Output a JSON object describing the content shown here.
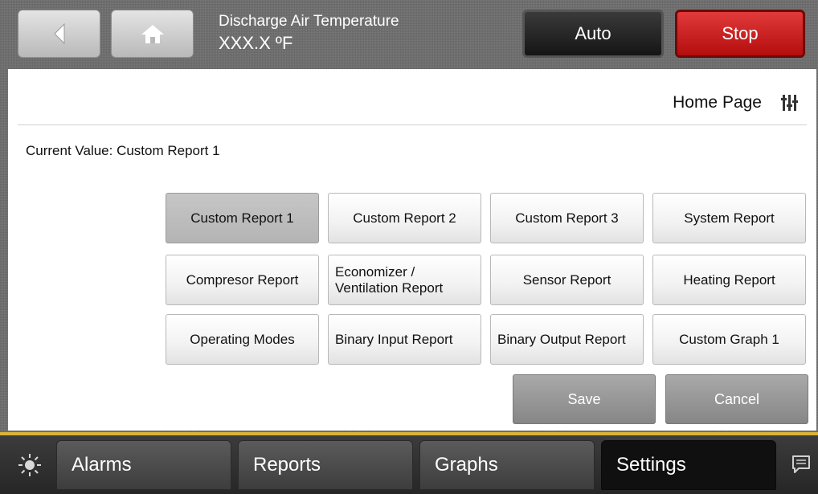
{
  "header": {
    "title": "Discharge Air Temperature",
    "value": "XXX.X ºF",
    "auto_label": "Auto",
    "stop_label": "Stop",
    "stop_color": "#c81818"
  },
  "panel": {
    "page_title": "Home Page",
    "current_value": "Current Value: Custom Report 1",
    "options": [
      {
        "label": "Custom Report 1",
        "selected": true
      },
      {
        "label": "Custom Report 2",
        "selected": false
      },
      {
        "label": "Custom Report 3",
        "selected": false
      },
      {
        "label": "System Report",
        "selected": false
      },
      {
        "label": "Compresor Report",
        "selected": false
      },
      {
        "label": "Economizer / Ventilation Report",
        "selected": false
      },
      {
        "label": "Sensor Report",
        "selected": false
      },
      {
        "label": "Heating Report",
        "selected": false
      },
      {
        "label": "Operating Modes",
        "selected": false
      },
      {
        "label": "Binary Input Report",
        "selected": false
      },
      {
        "label": "Binary Output Report",
        "selected": false
      },
      {
        "label": "Custom Graph 1",
        "selected": false
      }
    ],
    "save_label": "Save",
    "cancel_label": "Cancel"
  },
  "nav": {
    "tabs": [
      {
        "label": "Alarms",
        "active": false
      },
      {
        "label": "Reports",
        "active": false
      },
      {
        "label": "Graphs",
        "active": false
      },
      {
        "label": "Settings",
        "active": true
      }
    ],
    "accent_color": "#d9b43a"
  },
  "icons": {
    "back": "back-arrow-icon",
    "home": "home-icon",
    "settings": "sliders-icon",
    "brightness": "sun-icon",
    "messages": "chat-icon"
  }
}
